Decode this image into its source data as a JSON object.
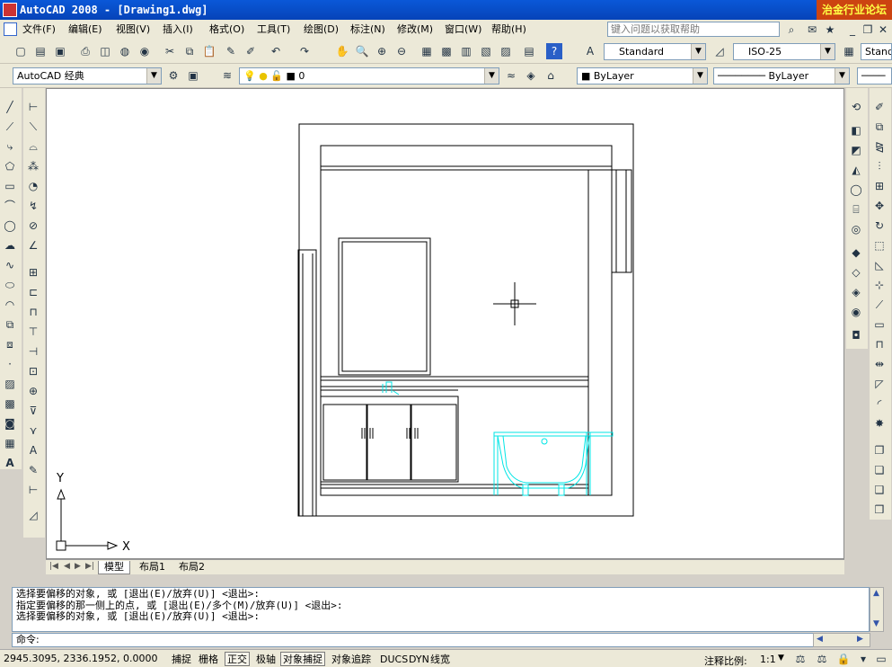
{
  "window": {
    "title": "AutoCAD 2008 - [Drawing1.dwg]",
    "watermark": "治金行业论坛 www"
  },
  "menu": [
    "文件(F)",
    "编辑(E)",
    "视图(V)",
    "插入(I)",
    "格式(O)",
    "工具(T)",
    "绘图(D)",
    "标注(N)",
    "修改(M)",
    "窗口(W)",
    "帮助(H)"
  ],
  "help_placeholder": "键入问题以获取帮助",
  "toolbar": {
    "text_style": "Standard",
    "dim_style": "ISO-25",
    "table_style": "Standard",
    "workspace": "AutoCAD 经典",
    "layer": "0",
    "color": "ByLayer",
    "linetype": "ByLayer"
  },
  "tabs": [
    "模型",
    "布局1",
    "布局2"
  ],
  "ucs": {
    "x": "X",
    "y": "Y"
  },
  "command": {
    "history": [
      "选择要偏移的对象, 或 [退出(E)/放弃(U)] <退出>:",
      "指定要偏移的那一侧上的点, 或 [退出(E)/多个(M)/放弃(U)] <退出>:",
      "选择要偏移的对象, 或 [退出(E)/放弃(U)] <退出>:"
    ],
    "prompt": "命令:"
  },
  "status": {
    "coords": "2945.3095, 2336.1952, 0.0000",
    "toggles": [
      "捕捉",
      "栅格",
      "正交",
      "极轴",
      "对象捕捉",
      "对象追踪",
      "DUCS",
      "DYN",
      "线宽"
    ],
    "annotation_scale_label": "注释比例:",
    "annotation_scale": "1:1"
  },
  "colors": {
    "drawing": "#000000",
    "fixture": "#00e5e5",
    "titlebar": "#0a58d8"
  }
}
